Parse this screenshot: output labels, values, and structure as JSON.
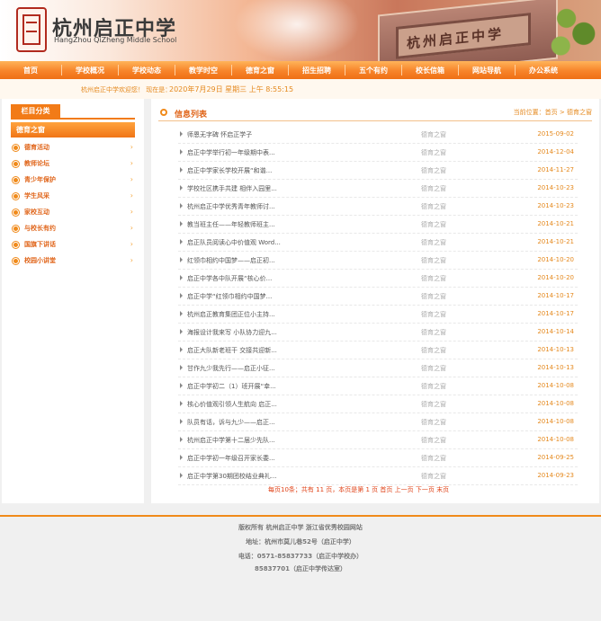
{
  "header": {
    "school_name": "杭州启正中学",
    "school_name_en": "HangZhou QiZheng Middle School",
    "plaque_text": "杭州启正中学"
  },
  "nav": {
    "items": [
      "首页",
      "学校概况",
      "学校动态",
      "教学时空",
      "德育之窗",
      "招生招聘",
      "五个有约",
      "校长信箱",
      "网站导航",
      "办公系统"
    ]
  },
  "datebar": {
    "welcome": "杭州启正中学欢迎您！ 现在是：",
    "clock": "2020年7月29日 星期三 上午 8:55:15"
  },
  "sidebar": {
    "category_label": "栏目分类",
    "section_title": "德育之窗",
    "items": [
      {
        "label": "德育活动"
      },
      {
        "label": "教师论坛"
      },
      {
        "label": "青少年保护"
      },
      {
        "label": "学生风采"
      },
      {
        "label": "家校互动"
      },
      {
        "label": "与校长有约"
      },
      {
        "label": "国旗下讲话"
      },
      {
        "label": "校园小讲堂"
      }
    ]
  },
  "main": {
    "title": "信息列表",
    "breadcrumb": "当前位置：首页 > 德育之窗",
    "rows": [
      {
        "title": "师恩无字碑 怀启正学子",
        "category": "德育之窗",
        "date": "2015-09-02"
      },
      {
        "title": "启正中学举行初一年级期中表...",
        "category": "德育之窗",
        "date": "2014-12-04"
      },
      {
        "title": "启正中学家长学校开展“和谐...",
        "category": "德育之窗",
        "date": "2014-11-27"
      },
      {
        "title": "学校社区携手共建 相伴入园里...",
        "category": "德育之窗",
        "date": "2014-10-23"
      },
      {
        "title": "杭州启正中学优秀青年教师讨...",
        "category": "德育之窗",
        "date": "2014-10-23"
      },
      {
        "title": "教当班主任——年轻教师班主...",
        "category": "德育之窗",
        "date": "2014-10-21"
      },
      {
        "title": "启正队员阅读心中价值观 Word...",
        "category": "德育之窗",
        "date": "2014-10-21"
      },
      {
        "title": "红领巾相约中国梦——启正初...",
        "category": "德育之窗",
        "date": "2014-10-20"
      },
      {
        "title": "启正中学各中队开展“核心价...",
        "category": "德育之窗",
        "date": "2014-10-20"
      },
      {
        "title": "启正中学“红领巾相约中国梦...",
        "category": "德育之窗",
        "date": "2014-10-17"
      },
      {
        "title": "杭州启正教育集团正位小主持...",
        "category": "德育之窗",
        "date": "2014-10-17"
      },
      {
        "title": "海报设计我来写 小队协力迎九...",
        "category": "德育之窗",
        "date": "2014-10-14"
      },
      {
        "title": "启正大队新老班干 交接共迎新...",
        "category": "德育之窗",
        "date": "2014-10-13"
      },
      {
        "title": "甘作九少我先行——启正小征...",
        "category": "德育之窗",
        "date": "2014-10-13"
      },
      {
        "title": "启正中学初二（1）班开展“幸...",
        "category": "德育之窗",
        "date": "2014-10-08"
      },
      {
        "title": "核心价值观引领人生航向 启正...",
        "category": "德育之窗",
        "date": "2014-10-08"
      },
      {
        "title": "队员有话，诉与九少——启正...",
        "category": "德育之窗",
        "date": "2014-10-08"
      },
      {
        "title": "杭州启正中学第十二届少先队...",
        "category": "德育之窗",
        "date": "2014-10-08"
      },
      {
        "title": "启正中学初一年级召开家长委...",
        "category": "德育之窗",
        "date": "2014-09-25"
      },
      {
        "title": "启正中学第30期团校结业典礼...",
        "category": "德育之窗",
        "date": "2014-09-23"
      }
    ],
    "pager": "每页10条；共有 11 页，本页是第 1 页 首页 上一页 下一页 末页"
  },
  "footer": {
    "line1": "版权所有 杭州启正中学   浙江省优秀校园网站",
    "line2": "地址：杭州市莫儿巷52号（启正中学）",
    "line3": "电话：0571-85837733（启正中学校办）",
    "line4": "85837701（启正中学传达室）"
  }
}
